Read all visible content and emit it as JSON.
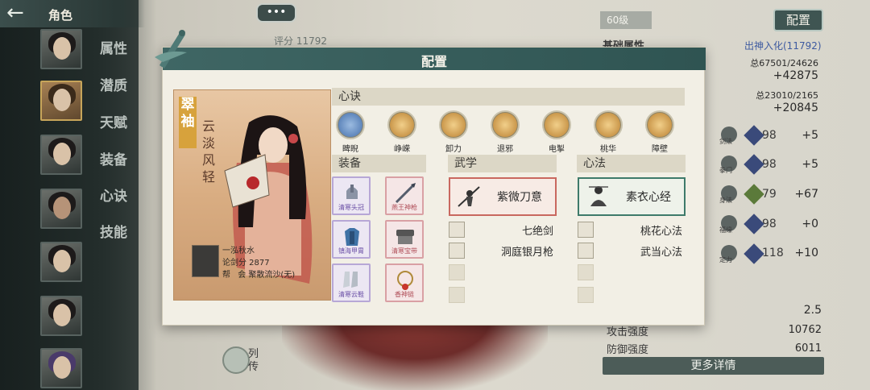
{
  "topbar": {
    "title": "角色"
  },
  "chat_bubble": {
    "label": "•••"
  },
  "side_menu": [
    "属性",
    "潜质",
    "天赋",
    "装备",
    "心诀",
    "技能"
  ],
  "background": {
    "score": "评分 11792",
    "level": "60级",
    "config_button": "配置",
    "base_attr_label": "基础属性",
    "realm": "出神入化(11792)",
    "hp_ratio": "总67501/24626",
    "hp_bonus": "+42875",
    "mp_ratio": "总23010/2165",
    "mp_bonus": "+20845",
    "stat_rows": [
      {
        "value": "98",
        "bonus": "+5"
      },
      {
        "value": "98",
        "bonus": "+5"
      },
      {
        "value": "79",
        "bonus": "+67"
      },
      {
        "value": "98",
        "bonus": "+0"
      },
      {
        "value": "118",
        "bonus": "+10"
      }
    ],
    "stat_row_names": [
      "剑法",
      "拳门",
      "身法",
      "福缘",
      "定力"
    ],
    "ratio_value": "2.5",
    "attack_label": "攻击强度",
    "attack_value": "10762",
    "defense_label": "防御强度",
    "defense_value": "6011",
    "more_button": "更多详情",
    "liezhuan": "列传"
  },
  "modal": {
    "title": "配置",
    "character": {
      "name": "翠袖",
      "subtitle": "云淡风轻",
      "player_name": "一泓秋水",
      "sword_score": "论剑分 2877",
      "guild_prefix": "帮",
      "guild": "会 聚散流沙(无)"
    },
    "xinjue_header": "心诀",
    "xinjue": [
      {
        "label": "睥睨",
        "color": "#5b8ccc"
      },
      {
        "label": "峥嵘",
        "color": "#c48a3a"
      },
      {
        "label": "卸力",
        "color": "#c48a3a"
      },
      {
        "label": "退邪",
        "color": "#c48a3a"
      },
      {
        "label": "电掣",
        "color": "#c48a3a"
      },
      {
        "label": "桃华",
        "color": "#c48a3a"
      },
      {
        "label": "障壁",
        "color": "#c48a3a"
      }
    ],
    "equipment_header": "装备",
    "equipment": [
      {
        "tag": "清寒头冠",
        "style": "purple"
      },
      {
        "tag": "燕王神枪",
        "style": "pink"
      },
      {
        "tag": "镇海甲胄",
        "style": "purple"
      },
      {
        "tag": "清寒宝带",
        "style": "pink"
      },
      {
        "tag": "清寒云鞋",
        "style": "purple"
      },
      {
        "tag": "香神链",
        "style": "pink"
      }
    ],
    "wuxue_header": "武学",
    "wuxue_main": "紫微刀意",
    "wuxue_list": [
      "七绝剑",
      "洞庭银月枪"
    ],
    "xinfa_header": "心法",
    "xinfa_main": "素衣心经",
    "xinfa_list": [
      "桃花心法",
      "武当心法"
    ]
  }
}
